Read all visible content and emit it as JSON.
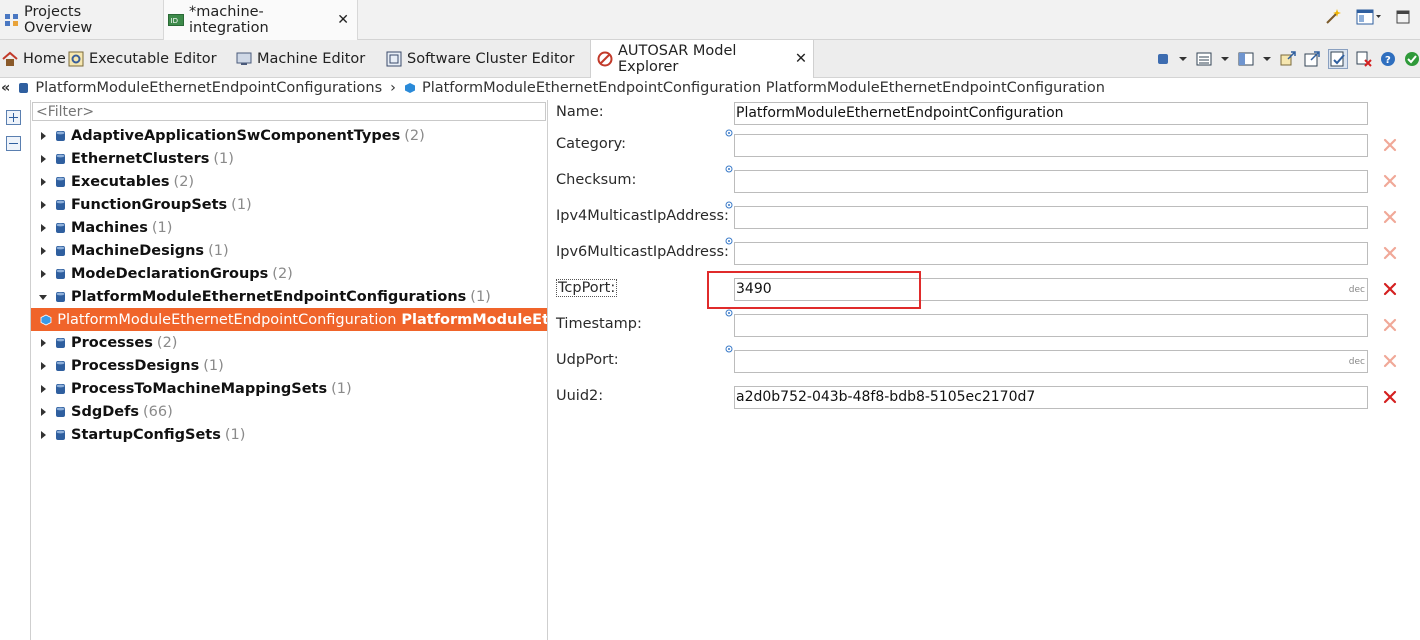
{
  "top_tabs": [
    {
      "label": "Projects Overview",
      "icon": "projects-overview-icon"
    },
    {
      "label": "*machine-integration",
      "icon": "id-editor-icon",
      "close": "✕"
    }
  ],
  "view_tabs": [
    {
      "label": "Home",
      "icon": "home-icon"
    },
    {
      "label": "Executable Editor",
      "icon": "executable-editor-icon"
    },
    {
      "label": "Machine Editor",
      "icon": "machine-editor-icon"
    },
    {
      "label": "Software Cluster Editor",
      "icon": "software-cluster-icon"
    },
    {
      "label": "AUTOSAR Model Explorer",
      "icon": "autosar-explorer-icon",
      "close": "✕",
      "active": true
    }
  ],
  "breadcrumb": {
    "back": "«",
    "items": [
      "PlatformModuleEthernetEndpointConfigurations",
      "PlatformModuleEthernetEndpointConfiguration PlatformModuleEthernetEndpointConfiguration"
    ],
    "separator": "›"
  },
  "tree": {
    "filter_placeholder": "<Filter>",
    "items": [
      {
        "label": "AdaptiveApplicationSwComponentTypes",
        "count": "(2)",
        "expanded": false
      },
      {
        "label": "EthernetClusters",
        "count": "(1)",
        "expanded": false
      },
      {
        "label": "Executables",
        "count": "(2)",
        "expanded": false
      },
      {
        "label": "FunctionGroupSets",
        "count": "(1)",
        "expanded": false
      },
      {
        "label": "Machines",
        "count": "(1)",
        "expanded": false
      },
      {
        "label": "MachineDesigns",
        "count": "(1)",
        "expanded": false
      },
      {
        "label": "ModeDeclarationGroups",
        "count": "(2)",
        "expanded": false
      },
      {
        "label": "PlatformModuleEthernetEndpointConfigurations",
        "count": "(1)",
        "expanded": true
      },
      {
        "label": "Processes",
        "count": "(2)",
        "expanded": false
      },
      {
        "label": "ProcessDesigns",
        "count": "(1)",
        "expanded": false
      },
      {
        "label": "ProcessToMachineMappingSets",
        "count": "(1)",
        "expanded": false
      },
      {
        "label": "SdgDefs",
        "count": "(66)",
        "expanded": false
      },
      {
        "label": "StartupConfigSets",
        "count": "(1)",
        "expanded": false
      }
    ],
    "selected_child": {
      "type_label": "PlatformModuleEthernetEndpointConfiguration",
      "name_label": "PlatformModuleEt"
    }
  },
  "properties": [
    {
      "label": "Name:",
      "value": "PlatformModuleEthernetEndpointConfiguration",
      "info": false,
      "delete": false
    },
    {
      "label": "Category:",
      "value": "",
      "info": true,
      "delete": true,
      "delete_active": false
    },
    {
      "label": "Checksum:",
      "value": "",
      "info": true,
      "delete": true,
      "delete_active": false
    },
    {
      "label": "Ipv4MulticastIpAddress:",
      "value": "",
      "info": true,
      "delete": true,
      "delete_active": false
    },
    {
      "label": "Ipv6MulticastIpAddress:",
      "value": "",
      "info": true,
      "delete": true,
      "delete_active": false
    },
    {
      "label": "TcpPort:",
      "value": "3490",
      "suffix": "dec",
      "info": false,
      "delete": true,
      "delete_active": true
    },
    {
      "label": "Timestamp:",
      "value": "",
      "info": true,
      "delete": true,
      "delete_active": false
    },
    {
      "label": "UdpPort:",
      "value": "",
      "suffix": "dec",
      "info": true,
      "delete": true,
      "delete_active": false
    },
    {
      "label": "Uuid2:",
      "value": "a2d0b752-043b-48f8-bdb8-5105ec2170d7",
      "info": false,
      "delete": true,
      "delete_active": true
    }
  ],
  "colors": {
    "selection": "#f0642a",
    "highlight_box": "#e02b2b",
    "delete_active": "#d42020",
    "delete_inactive": "#f0a898"
  }
}
